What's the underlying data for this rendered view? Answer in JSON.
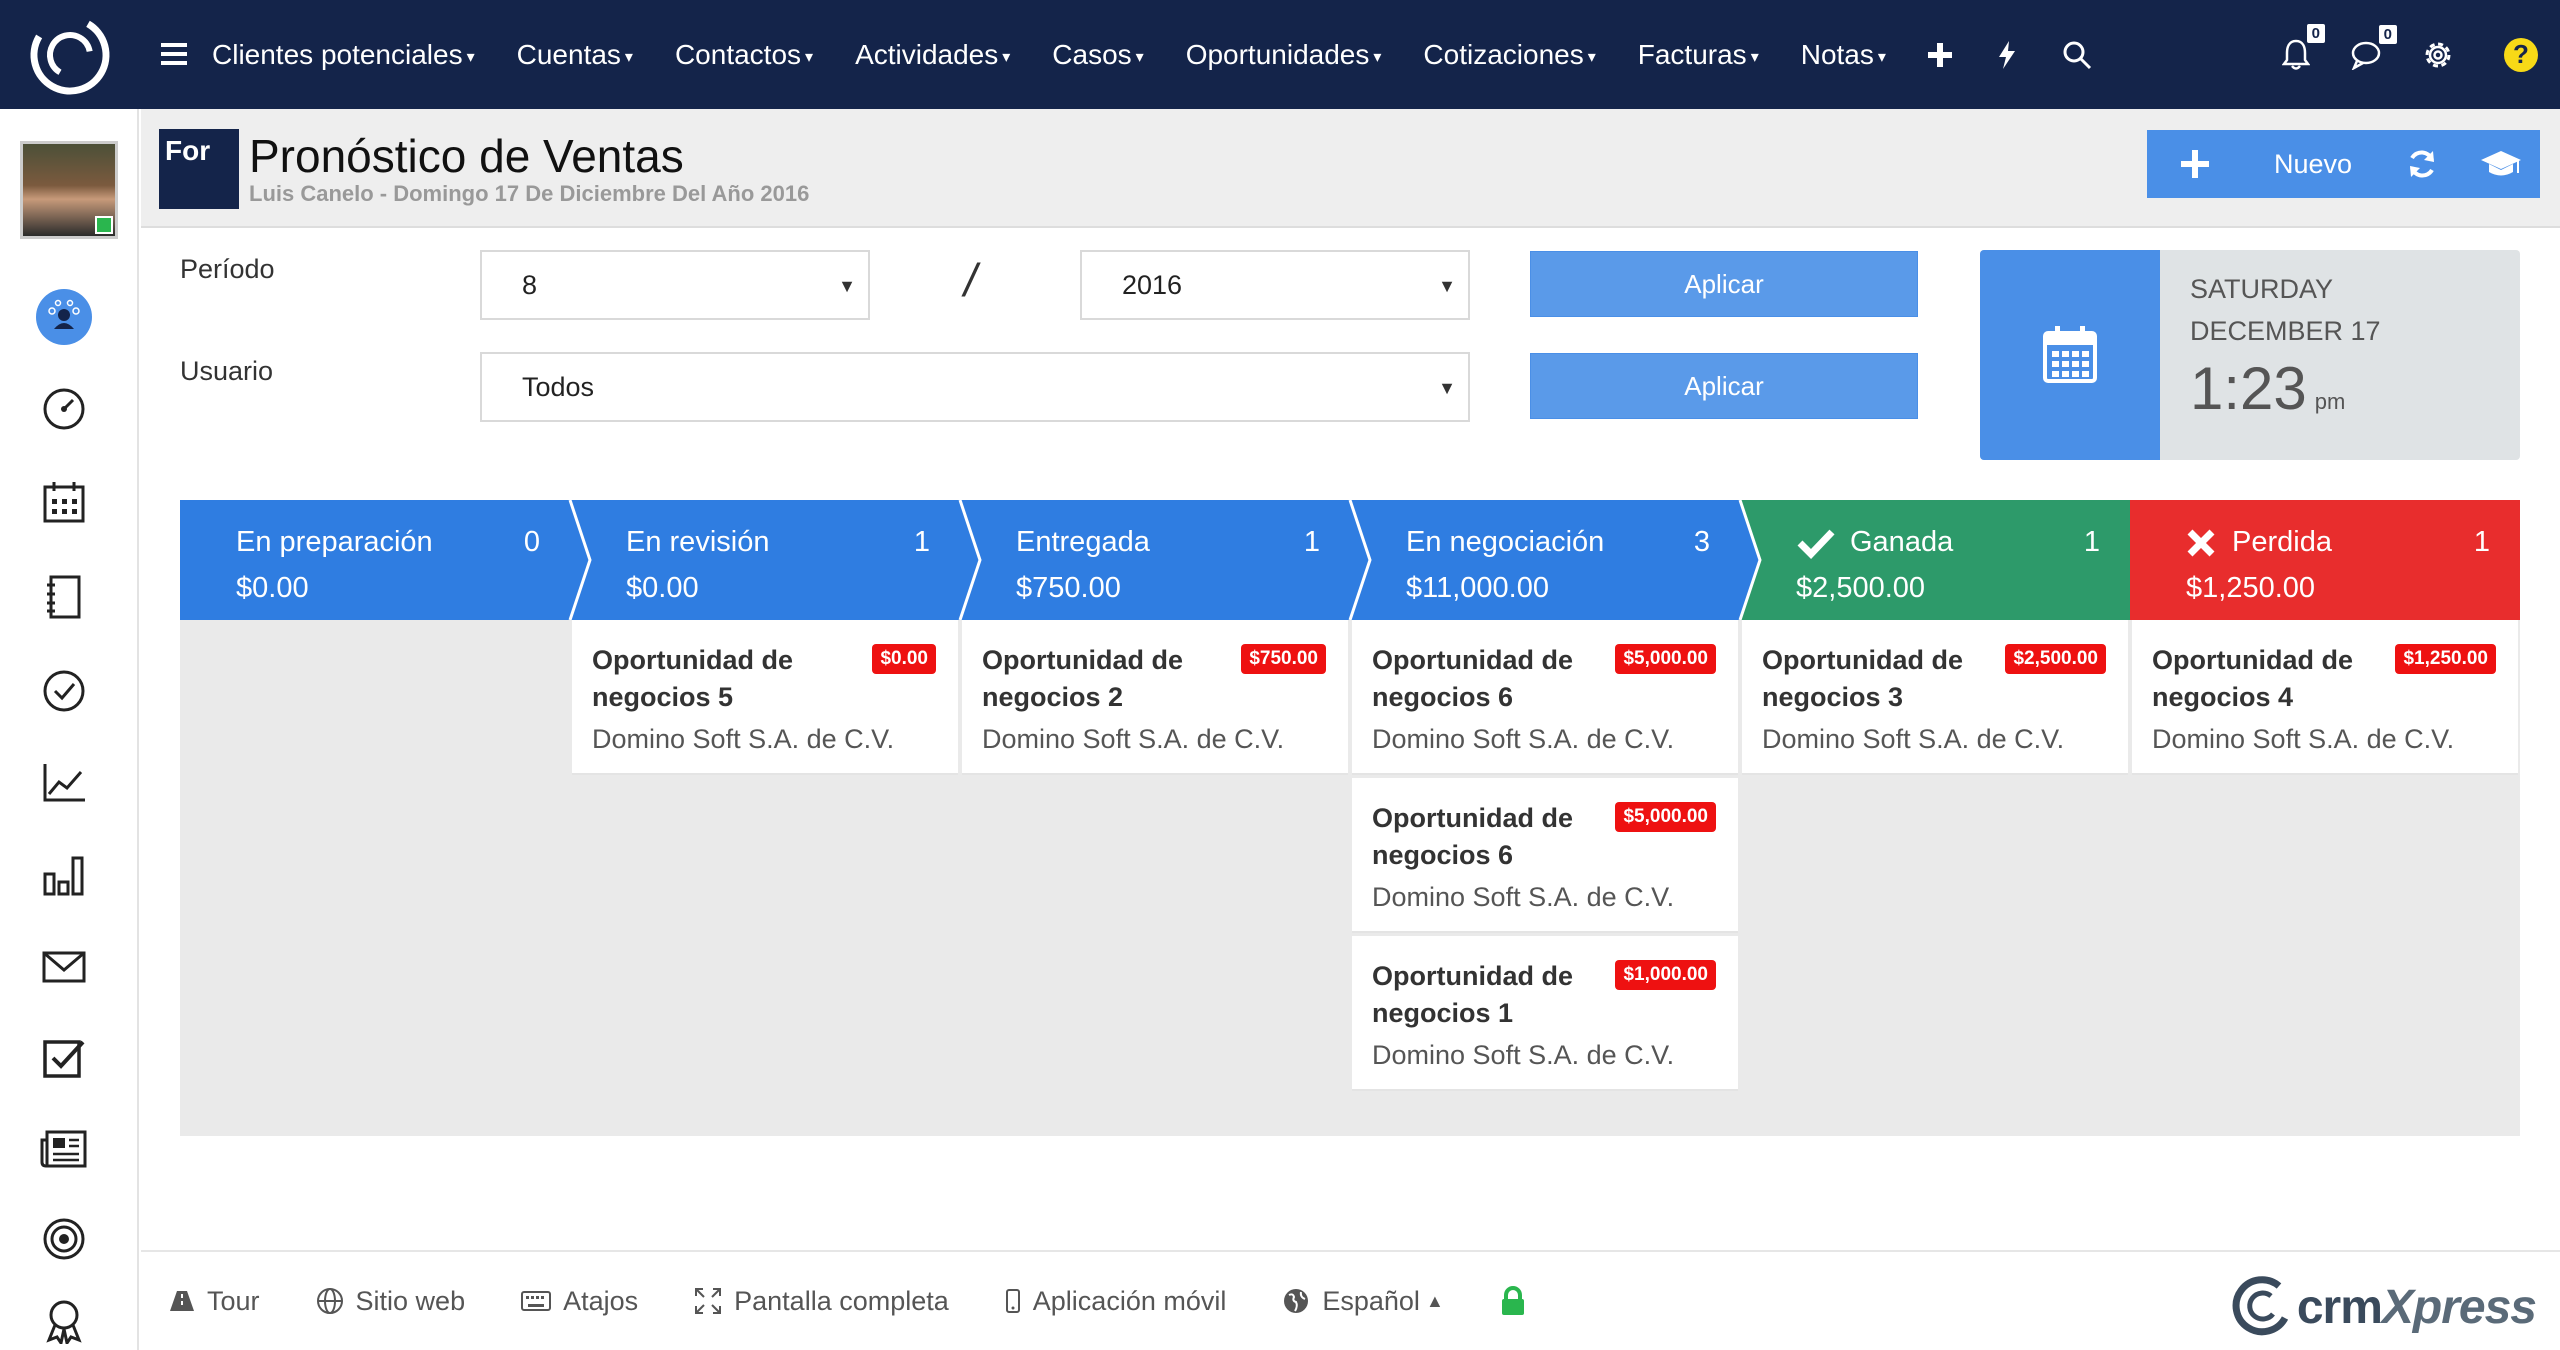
{
  "nav": {
    "items": [
      {
        "label": "Clientes potenciales"
      },
      {
        "label": "Cuentas"
      },
      {
        "label": "Contactos"
      },
      {
        "label": "Actividades"
      },
      {
        "label": "Casos"
      },
      {
        "label": "Oportunidades"
      },
      {
        "label": "Cotizaciones"
      },
      {
        "label": "Facturas"
      },
      {
        "label": "Notas"
      }
    ],
    "notifications_count": "0",
    "messages_count": "0",
    "help_label": "?"
  },
  "page": {
    "module_badge": "For",
    "title": "Pronóstico de Ventas",
    "subtitle": "Luis Canelo - Domingo 17 De Diciembre Del Año 2016",
    "toolbar": {
      "new_label": "Nuevo"
    }
  },
  "filters": {
    "period_label": "Período",
    "period_month": "8",
    "period_separator": "/",
    "period_year": "2016",
    "user_label": "Usuario",
    "user_value": "Todos",
    "apply_label": "Aplicar"
  },
  "date_widget": {
    "weekday": "SATURDAY",
    "date": "DECEMBER 17",
    "time": "1:23",
    "ampm": "pm"
  },
  "colors": {
    "navbar": "#14244a",
    "accent": "#4a8fe7",
    "stage_blue": "#2f7de1",
    "stage_won": "#2d9a6a",
    "stage_lost": "#e82d2d",
    "amount_badge": "#ee1111"
  },
  "stages": [
    {
      "name": "En preparación",
      "count": "0",
      "amount": "$0.00",
      "cards": []
    },
    {
      "name": "En revisión",
      "count": "1",
      "amount": "$0.00",
      "cards": [
        {
          "title": "Oportunidad de negocios 5",
          "amount": "$0.00",
          "company": "Domino Soft S.A. de C.V."
        }
      ]
    },
    {
      "name": "Entregada",
      "count": "1",
      "amount": "$750.00",
      "cards": [
        {
          "title": "Oportunidad de negocios 2",
          "amount": "$750.00",
          "company": "Domino Soft S.A. de C.V."
        }
      ]
    },
    {
      "name": "En negociación",
      "count": "3",
      "amount": "$11,000.00",
      "cards": [
        {
          "title": "Oportunidad de negocios 6",
          "amount": "$5,000.00",
          "company": "Domino Soft S.A. de C.V."
        },
        {
          "title": "Oportunidad de negocios 6",
          "amount": "$5,000.00",
          "company": "Domino Soft S.A. de C.V."
        },
        {
          "title": "Oportunidad de negocios 1",
          "amount": "$1,000.00",
          "company": "Domino Soft S.A. de C.V."
        }
      ]
    },
    {
      "name": "Ganada",
      "count": "1",
      "amount": "$2,500.00",
      "cards": [
        {
          "title": "Oportunidad de negocios 3",
          "amount": "$2,500.00",
          "company": "Domino Soft S.A. de C.V."
        }
      ]
    },
    {
      "name": "Perdida",
      "count": "1",
      "amount": "$1,250.00",
      "cards": [
        {
          "title": "Oportunidad de negocios 4",
          "amount": "$1,250.00",
          "company": "Domino Soft S.A. de C.V."
        }
      ]
    }
  ],
  "footer": {
    "tour": "Tour",
    "website": "Sitio web",
    "shortcuts": "Atajos",
    "fullscreen": "Pantalla completa",
    "mobile_app": "Aplicación móvil",
    "language": "Español",
    "brand_prefix": "crm",
    "brand_suffix": "Xpress"
  }
}
